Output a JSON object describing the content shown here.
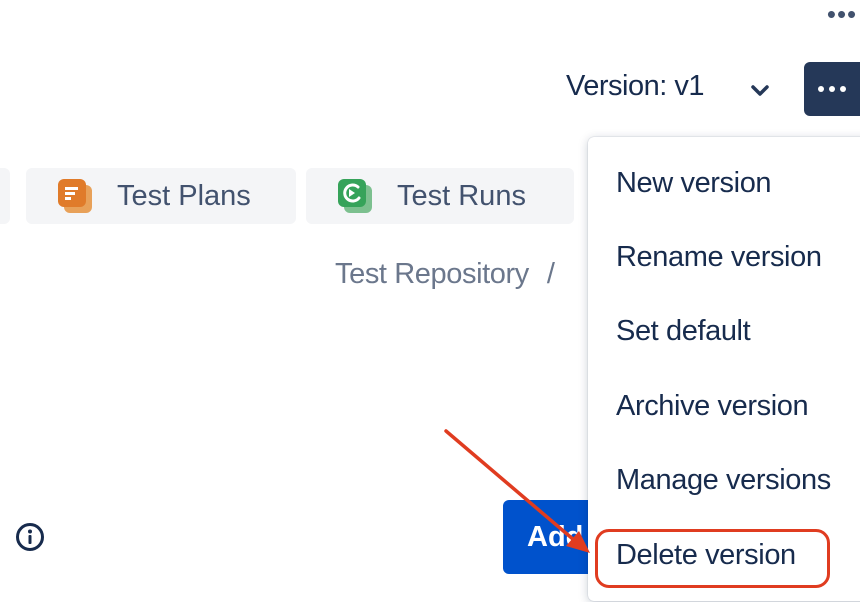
{
  "header": {
    "version_label": "Version: v1",
    "icons": {
      "top_more": "more-horizontal-icon",
      "chevron": "chevron-down-icon",
      "more_button": "more-horizontal-icon"
    }
  },
  "tabs": [
    {
      "label": "Test Plans",
      "icon": "test-plans-icon",
      "icon_color": "#e07b2a"
    },
    {
      "label": "Test Runs",
      "icon": "test-runs-icon",
      "icon_color": "#36a35a"
    }
  ],
  "breadcrumb": {
    "item": "Test Repository",
    "separator": "/"
  },
  "add_button": {
    "label": "Add"
  },
  "menu": {
    "items": [
      {
        "label": "New version"
      },
      {
        "label": "Rename version"
      },
      {
        "label": "Set default"
      },
      {
        "label": "Archive version"
      },
      {
        "label": "Manage versions"
      },
      {
        "label": "Delete version"
      }
    ]
  },
  "colors": {
    "primary_button": "#0052cc",
    "dark_button": "#253858",
    "annotation": "#e03c20"
  }
}
